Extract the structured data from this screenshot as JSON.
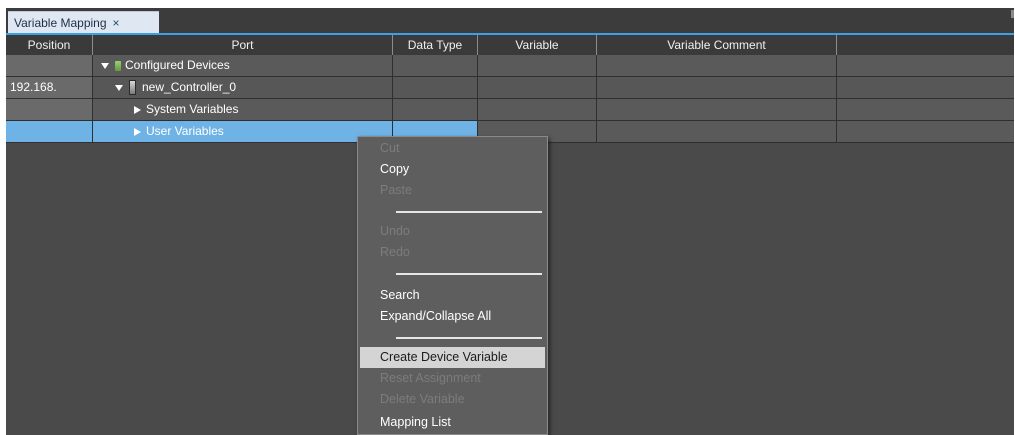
{
  "tab": {
    "title": "Variable Mapping",
    "close": "×"
  },
  "columns": [
    "Position",
    "Port",
    "Data Type",
    "Variable",
    "Variable Comment"
  ],
  "rows": [
    {
      "position": "",
      "port": "Configured Devices"
    },
    {
      "position": "192.168.",
      "port": "new_Controller_0"
    },
    {
      "position": "",
      "port": "System Variables"
    },
    {
      "position": "",
      "port": "User Variables"
    }
  ],
  "context_menu": {
    "items": [
      {
        "label": "Cut",
        "enabled": false
      },
      {
        "label": "Copy",
        "enabled": true
      },
      {
        "label": "Paste",
        "enabled": false
      },
      {
        "label": "Undo",
        "enabled": false
      },
      {
        "label": "Redo",
        "enabled": false
      },
      {
        "label": "Search",
        "enabled": true
      },
      {
        "label": "Expand/Collapse All",
        "enabled": true
      },
      {
        "label": "Create Device Variable",
        "enabled": true,
        "highlighted": true
      },
      {
        "label": "Reset Assignment",
        "enabled": false
      },
      {
        "label": "Delete Variable",
        "enabled": false
      },
      {
        "label": "Mapping List",
        "enabled": true
      }
    ]
  },
  "colors": {
    "background": "#4a4a4a",
    "header": "#3a3a3a",
    "selection": "#6fb3e6",
    "tab": "#dfe8f2",
    "accent": "#3ba0e6"
  },
  "icons": {
    "tab_close": "close-icon",
    "expand": "triangle-down-icon",
    "collapse": "triangle-right-icon",
    "device_group": "device-group-icon",
    "controller": "controller-icon"
  }
}
